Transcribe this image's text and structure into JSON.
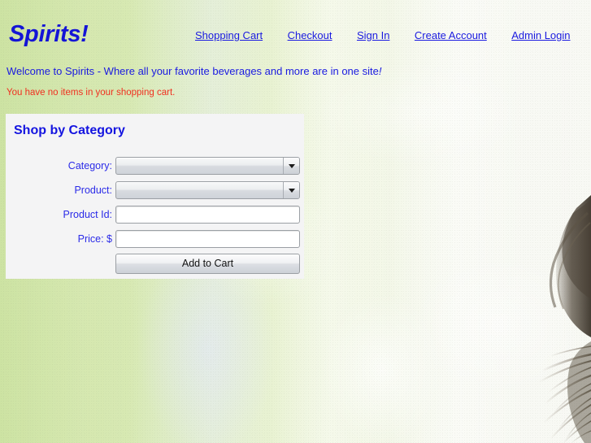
{
  "site": {
    "logo": "Spirits!",
    "tagline_text": "Welcome to Spirits - Where all your favorite beverages and more are in one site",
    "tagline_excl": "!",
    "cart_status": "You have no items in your shopping cart."
  },
  "nav": {
    "items": [
      {
        "label": "Shopping Cart",
        "name": "nav-link-shopping-cart"
      },
      {
        "label": "Checkout",
        "name": "nav-link-checkout"
      },
      {
        "label": "Sign In",
        "name": "nav-link-sign-in"
      },
      {
        "label": "Create Account",
        "name": "nav-link-create-account"
      },
      {
        "label": "Admin Login",
        "name": "nav-link-admin-login"
      }
    ]
  },
  "shop_panel": {
    "title": "Shop by Category",
    "fields": {
      "category": {
        "label": "Category:",
        "value": "",
        "type": "select"
      },
      "product": {
        "label": "Product:",
        "value": "",
        "type": "select"
      },
      "product_id": {
        "label": "Product Id:",
        "value": "",
        "placeholder": "",
        "type": "text"
      },
      "price": {
        "label": "Price: $",
        "value": "",
        "placeholder": "",
        "type": "text"
      }
    },
    "submit_label": "Add to Cart"
  },
  "colors": {
    "link_blue": "#1a1ae0",
    "heading_blue": "#1414e0",
    "alert_red": "#f03020",
    "bg_green": "#cde3a3",
    "bg_cream": "#f8f9f4",
    "panel_bg": "#f4f4f5"
  },
  "background": {
    "description": "decorative-hair-photo",
    "position": "right-edge"
  }
}
